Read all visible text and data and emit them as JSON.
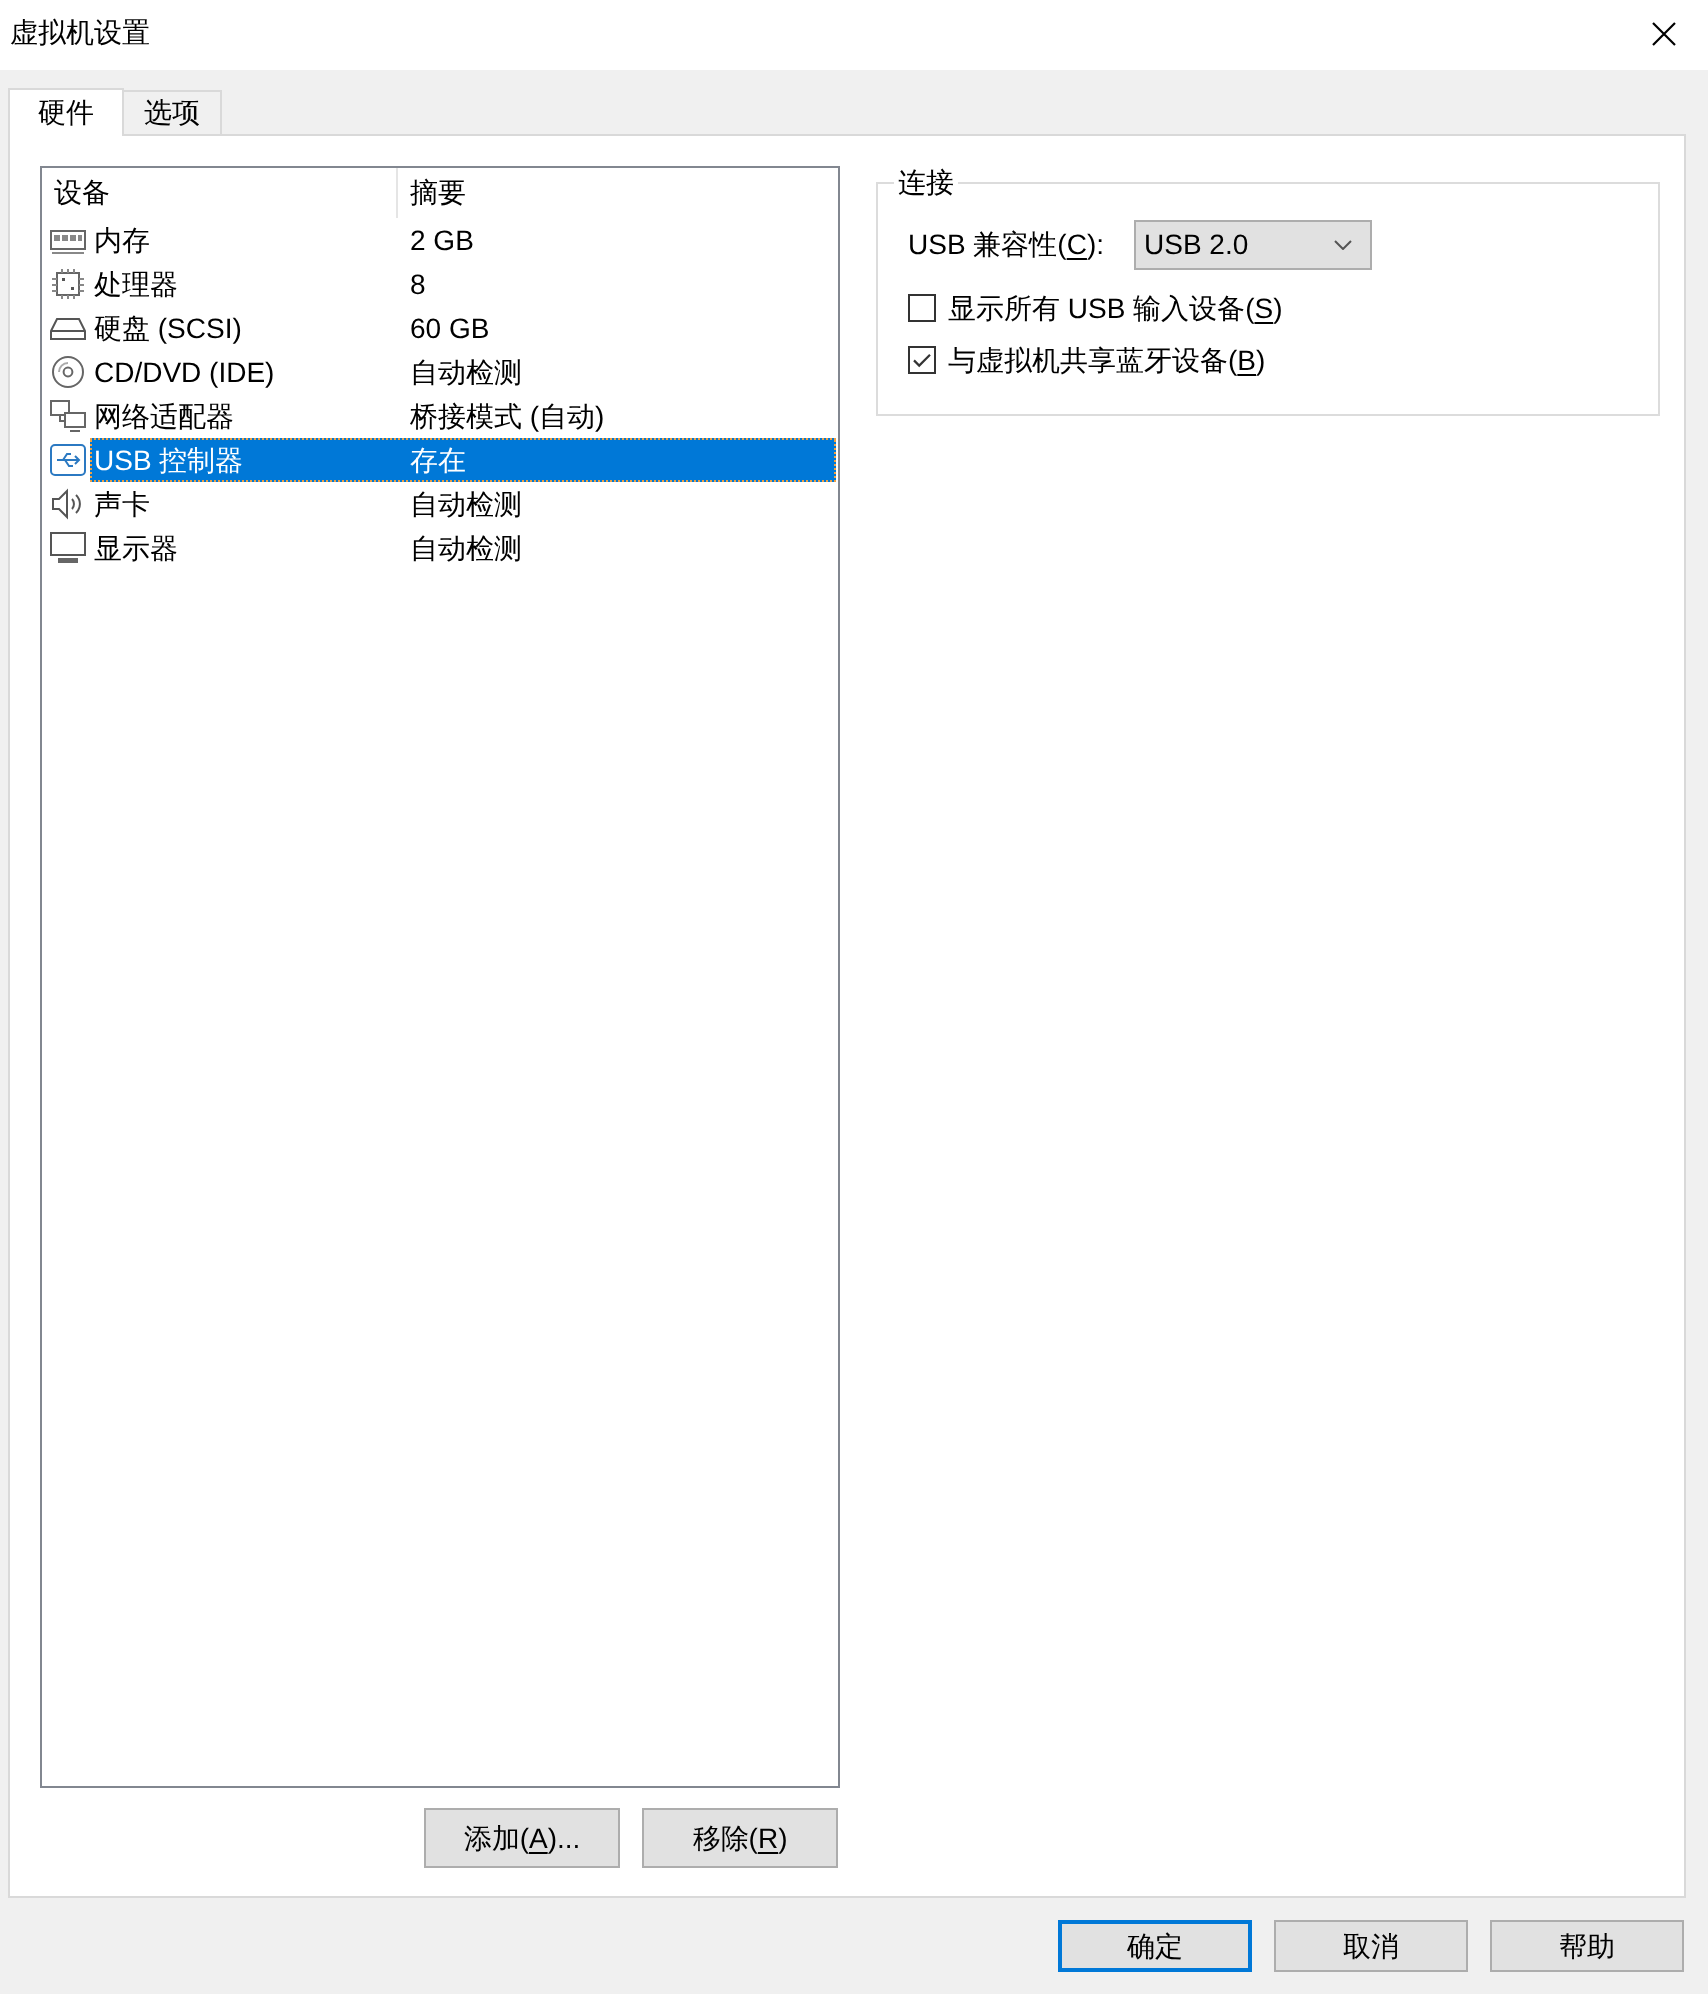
{
  "window": {
    "title": "虚拟机设置"
  },
  "tabs": [
    {
      "label": "硬件",
      "selected": true
    },
    {
      "label": "选项",
      "selected": false
    }
  ],
  "device_list": {
    "columns": [
      "设备",
      "摘要"
    ],
    "rows": [
      {
        "kind": "memory",
        "device": "内存",
        "summary": "2 GB",
        "selected": false
      },
      {
        "kind": "processor",
        "device": "处理器",
        "summary": "8",
        "selected": false
      },
      {
        "kind": "hard_disk",
        "device": "硬盘 (SCSI)",
        "summary": "60 GB",
        "selected": false
      },
      {
        "kind": "cd_dvd",
        "device": "CD/DVD (IDE)",
        "summary": "自动检测",
        "selected": false
      },
      {
        "kind": "network",
        "device": "网络适配器",
        "summary": "桥接模式 (自动)",
        "selected": false
      },
      {
        "kind": "usb",
        "device": "USB 控制器",
        "summary": "存在",
        "selected": true
      },
      {
        "kind": "sound",
        "device": "声卡",
        "summary": "自动检测",
        "selected": false
      },
      {
        "kind": "display",
        "device": "显示器",
        "summary": "自动检测",
        "selected": false
      }
    ]
  },
  "list_buttons": [
    {
      "label_before": "添加(",
      "access_key": "A",
      "label_after": ")..."
    },
    {
      "label_before": "移除(",
      "access_key": "R",
      "label_after": ")"
    }
  ],
  "connection_group": {
    "title": "连接",
    "compatibility": {
      "label_before": "USB 兼容性(",
      "access_key": "C",
      "label_after": "):",
      "value": "USB 2.0"
    },
    "checkboxes": [
      {
        "label_before": "显示所有 USB 输入设备(",
        "access_key": "S",
        "label_after": ")",
        "checked": false
      },
      {
        "label_before": "与虚拟机共享蓝牙设备(",
        "access_key": "B",
        "label_after": ")",
        "checked": true
      }
    ]
  },
  "dialog_buttons": [
    {
      "label": "确定",
      "default": true
    },
    {
      "label": "取消",
      "default": false
    },
    {
      "label": "帮助",
      "default": false
    }
  ]
}
